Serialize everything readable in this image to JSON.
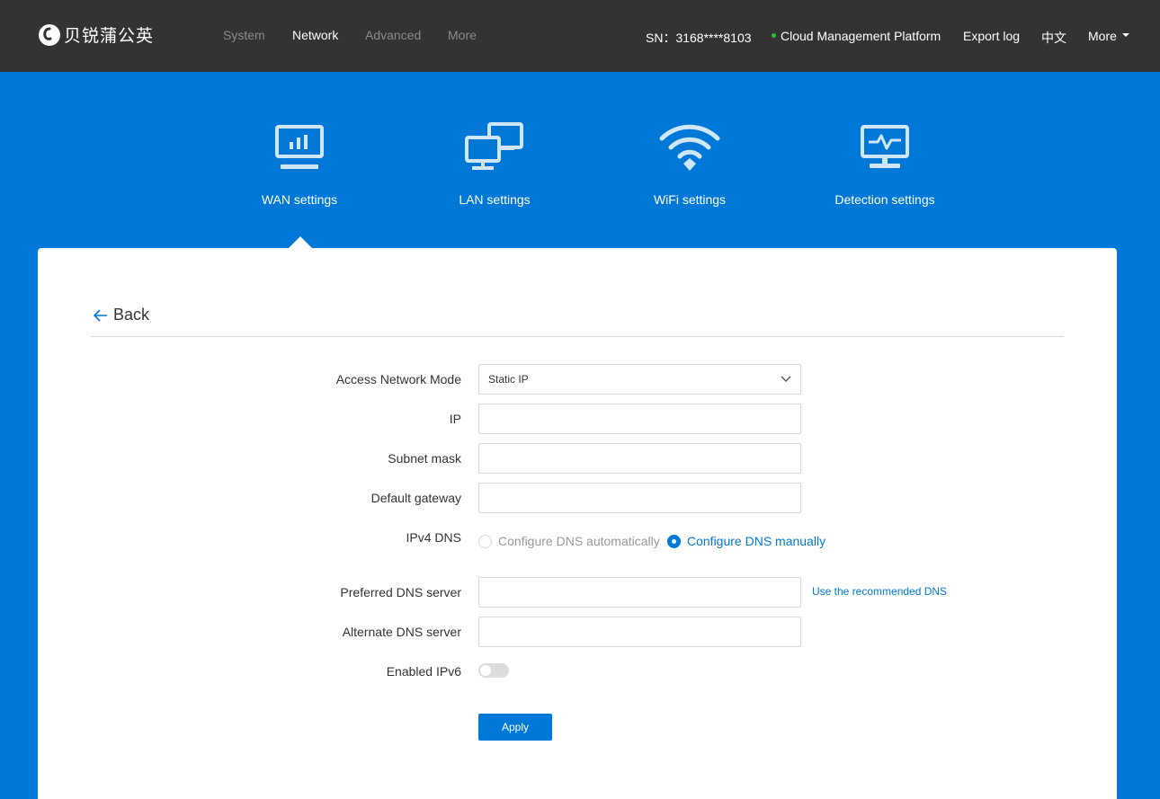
{
  "brand": {
    "name": "贝锐蒲公英"
  },
  "topnav": {
    "items": [
      {
        "label": "System",
        "active": false
      },
      {
        "label": "Network",
        "active": true
      },
      {
        "label": "Advanced",
        "active": false
      },
      {
        "label": "More",
        "active": false
      }
    ]
  },
  "header_right": {
    "sn": "SN：3168****8103",
    "cloud_label": "Cloud Management Platform",
    "cloud_status_color": "#22c32e",
    "export_log": "Export log",
    "language": "中文",
    "more": "More"
  },
  "tabs": [
    {
      "label": "WAN settings",
      "icon": "monitor-chart-icon",
      "active": true
    },
    {
      "label": "LAN settings",
      "icon": "lan-computers-icon",
      "active": false
    },
    {
      "label": "WiFi settings",
      "icon": "wifi-icon",
      "active": false
    },
    {
      "label": "Detection settings",
      "icon": "monitor-pulse-icon",
      "active": false
    }
  ],
  "form": {
    "back_label": "Back",
    "access_mode": {
      "label": "Access Network Mode",
      "value": "Static IP"
    },
    "ip": {
      "label": "IP",
      "value": ""
    },
    "subnet_mask": {
      "label": "Subnet mask",
      "value": ""
    },
    "gateway": {
      "label": "Default gateway",
      "value": ""
    },
    "ipv4_dns": {
      "label": "IPv4 DNS",
      "options": [
        {
          "label": "Configure DNS automatically",
          "selected": false
        },
        {
          "label": "Configure DNS manually",
          "selected": true
        }
      ]
    },
    "preferred_dns": {
      "label": "Preferred DNS server",
      "value": "",
      "link": "Use the recommended DNS"
    },
    "alternate_dns": {
      "label": "Alternate DNS server",
      "value": ""
    },
    "ipv6": {
      "label": "Enabled IPv6",
      "enabled": false
    },
    "apply_label": "Apply"
  },
  "colors": {
    "accent": "#0078d7",
    "topbar": "#333333"
  }
}
